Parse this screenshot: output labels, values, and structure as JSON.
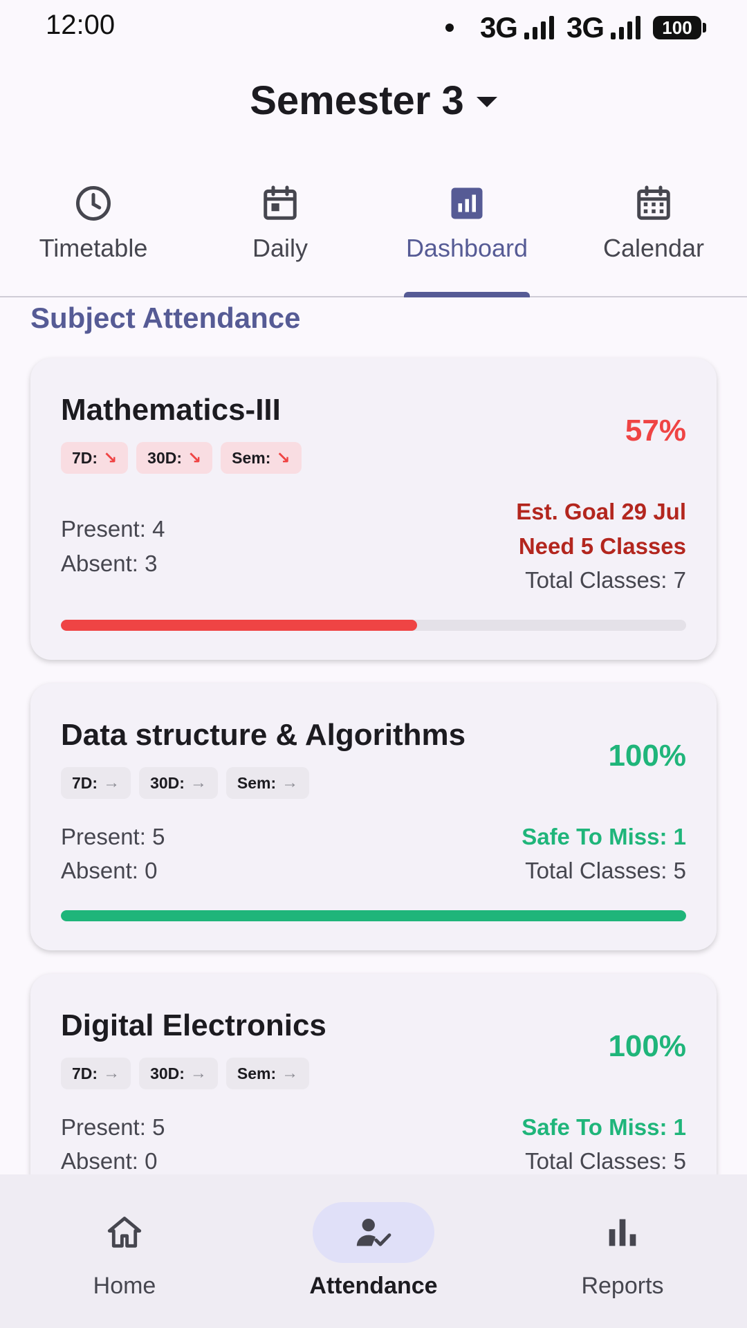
{
  "status_bar": {
    "time": "12:00",
    "network1": "3G",
    "network2": "3G",
    "battery": "100"
  },
  "header": {
    "semester": "Semester 3"
  },
  "tabs": [
    {
      "label": "Timetable",
      "icon": "clock-icon",
      "active": false
    },
    {
      "label": "Daily",
      "icon": "calendar-day-icon",
      "active": false
    },
    {
      "label": "Dashboard",
      "icon": "chart-icon",
      "active": true
    },
    {
      "label": "Calendar",
      "icon": "calendar-month-icon",
      "active": false
    }
  ],
  "section_title": "Subject Attendance",
  "subjects": [
    {
      "name": "Mathematics-III",
      "percent": "57%",
      "chips": [
        {
          "label": "7D:",
          "trend": "down"
        },
        {
          "label": "30D:",
          "trend": "down"
        },
        {
          "label": "Sem:",
          "trend": "down"
        }
      ],
      "present": "Present: 4",
      "absent": "Absent: 3",
      "goal": "Est. Goal 29 Jul",
      "need": "Need 5 Classes",
      "total": "Total Classes: 7",
      "progress": 0.57
    },
    {
      "name": "Data structure & Algorithms",
      "percent": "100%",
      "chips": [
        {
          "label": "7D:",
          "trend": "flat"
        },
        {
          "label": "30D:",
          "trend": "flat"
        },
        {
          "label": "Sem:",
          "trend": "flat"
        }
      ],
      "present": "Present: 5",
      "absent": "Absent: 0",
      "safe": "Safe To Miss: 1",
      "total": "Total Classes: 5",
      "progress": 1.0
    },
    {
      "name": "Digital Electronics",
      "percent": "100%",
      "chips": [
        {
          "label": "7D:",
          "trend": "flat"
        },
        {
          "label": "30D:",
          "trend": "flat"
        },
        {
          "label": "Sem:",
          "trend": "flat"
        }
      ],
      "present": "Present: 5",
      "absent": "Absent: 0",
      "safe": "Safe To Miss: 1",
      "total": "Total Classes: 5",
      "progress": 1.0
    }
  ],
  "colors": {
    "accent": "#565b95",
    "danger": "#ef4444",
    "danger_text": "#b3261e",
    "success": "#1fb57a",
    "chip_danger_bg": "#f9dde2",
    "chip_neutral_bg": "#ebe8ee"
  },
  "bottom_nav": [
    {
      "label": "Home",
      "icon": "home-icon",
      "active": false
    },
    {
      "label": "Attendance",
      "icon": "person-check-icon",
      "active": true
    },
    {
      "label": "Reports",
      "icon": "bar-chart-icon",
      "active": false
    }
  ]
}
